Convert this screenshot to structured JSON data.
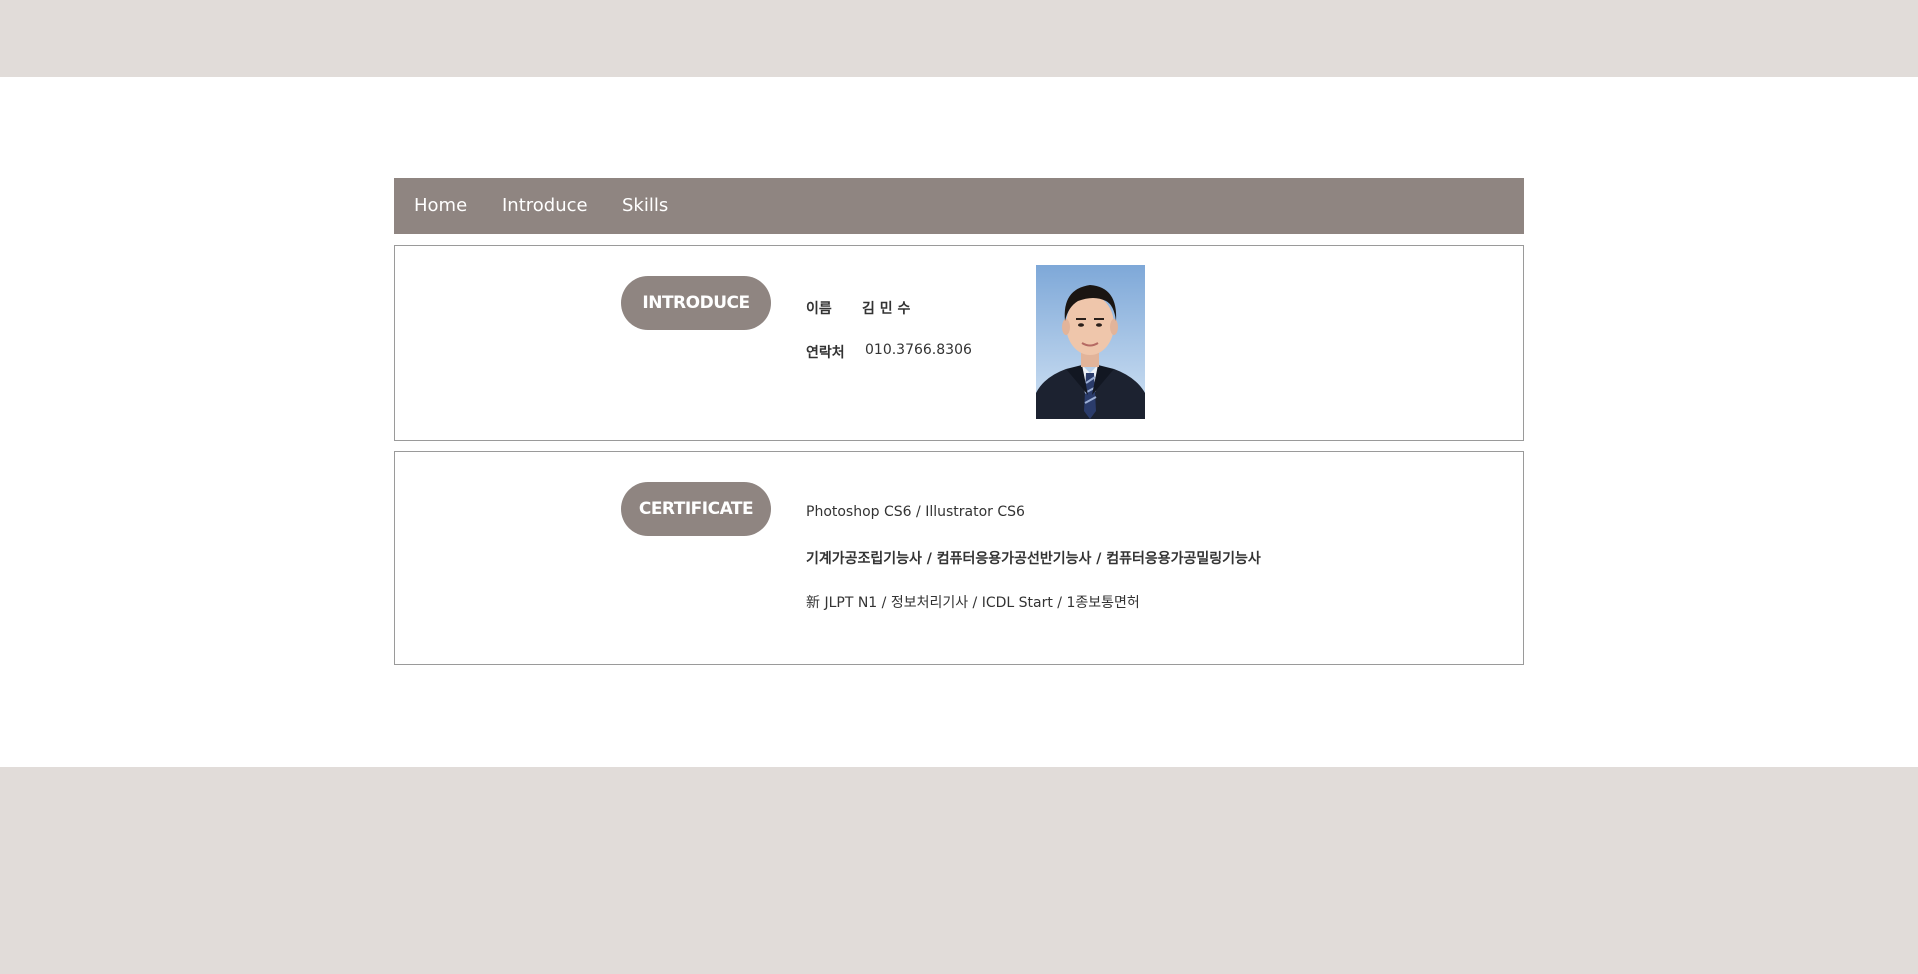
{
  "nav": {
    "items": [
      {
        "label": "Home"
      },
      {
        "label": "Introduce"
      },
      {
        "label": "Skills"
      }
    ]
  },
  "introduce": {
    "section_label": "INTRODUCE",
    "name_label": "이름",
    "name_value": "김 민 수",
    "contact_label": "연락처",
    "contact_value": "010.3766.8306"
  },
  "certificate": {
    "section_label": "CERTIFICATE",
    "lines": [
      "Photoshop CS6 / Illustrator CS6",
      "기계가공조립기능사 / 컴퓨터응용가공선반기능사 / 컴퓨터응용가공밀링기능사",
      "新 JLPT N1 / 정보처리기사 / ICDL Start / 1종보통면허"
    ]
  },
  "colors": {
    "accent": "#8f8581",
    "band": "#e1dcd9",
    "text": "#333333"
  }
}
